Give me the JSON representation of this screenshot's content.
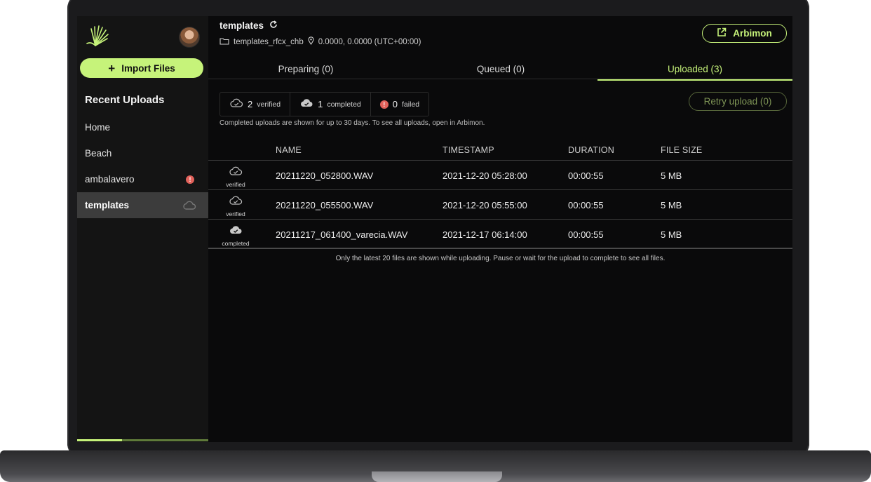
{
  "sidebar": {
    "import_label": "Import Files",
    "recent_title": "Recent Uploads",
    "items": [
      {
        "label": "Home"
      },
      {
        "label": "Beach"
      },
      {
        "label": "ambalavero",
        "error_badge": "!"
      },
      {
        "label": "templates",
        "active": true
      }
    ],
    "upload_progress": 0.34
  },
  "header": {
    "title": "templates",
    "site": "templates_rfcx_chb",
    "location": "0.0000, 0.0000 (UTC+00:00)",
    "arbimon_label": "Arbimon"
  },
  "tabs": [
    {
      "label": "Preparing (0)"
    },
    {
      "label": "Queued (0)"
    },
    {
      "label": "Uploaded (3)",
      "active": true
    }
  ],
  "summary": {
    "verified_count": "2",
    "verified_label": "verified",
    "completed_count": "1",
    "completed_label": "completed",
    "failed_count": "0",
    "failed_label": "failed",
    "failed_icon_text": "!"
  },
  "retry_label": "Retry upload (0)",
  "note": "Completed uploads are shown for up to 30 days. To see all uploads, open in Arbimon.",
  "table": {
    "headers": {
      "name": "NAME",
      "timestamp": "TIMESTAMP",
      "duration": "DURATION",
      "size": "FILE SIZE"
    },
    "rows": [
      {
        "status": "verified",
        "name": "20211220_052800.WAV",
        "timestamp": "2021-12-20 05:28:00",
        "duration": "00:00:55",
        "size": "5 MB"
      },
      {
        "status": "verified",
        "name": "20211220_055500.WAV",
        "timestamp": "2021-12-20 05:55:00",
        "duration": "00:00:55",
        "size": "5 MB"
      },
      {
        "status": "completed",
        "name": "20211217_061400_varecia.WAV",
        "timestamp": "2021-12-17 06:14:00",
        "duration": "00:00:55",
        "size": "5 MB"
      }
    ]
  },
  "footer_note": "Only the latest 20 files are shown while uploading. Pause or wait for the upload to complete to see all files.",
  "colors": {
    "accent": "#c6f37a",
    "error": "#e2625b",
    "background": "#0a0a0b",
    "sidebar": "#141414"
  },
  "icons": [
    "logo-icon",
    "plus-icon",
    "cloud-outline-icon",
    "cloud-check-icon",
    "refresh-icon",
    "folder-icon",
    "location-pin-icon",
    "external-link-icon"
  ]
}
